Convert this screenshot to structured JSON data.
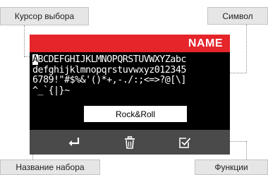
{
  "callouts": {
    "cursor": "Курсор выбора",
    "symbol": "Символ",
    "set_name": "Название набора",
    "functions": "Функции"
  },
  "screen": {
    "title": "NAME",
    "cursor_char": "A",
    "rows": [
      "BCDEFGHIJKLMNOPQRSTUVWXYZabc",
      "defghijklmnopqrstuvwxyz012345",
      "6789!\"#$%&'()*+,-./:;<=>?@[\\]",
      "^_`{|}~"
    ],
    "set_name_value": "Rock&Roll",
    "function_icons": [
      "enter-icon",
      "trash-icon",
      "checkbox-icon"
    ]
  },
  "colors": {
    "title_bar": "#e5252a",
    "screen_bg": "#000000",
    "function_bar": "#4a4a4a",
    "callout_bg": "#e6e6e6"
  }
}
